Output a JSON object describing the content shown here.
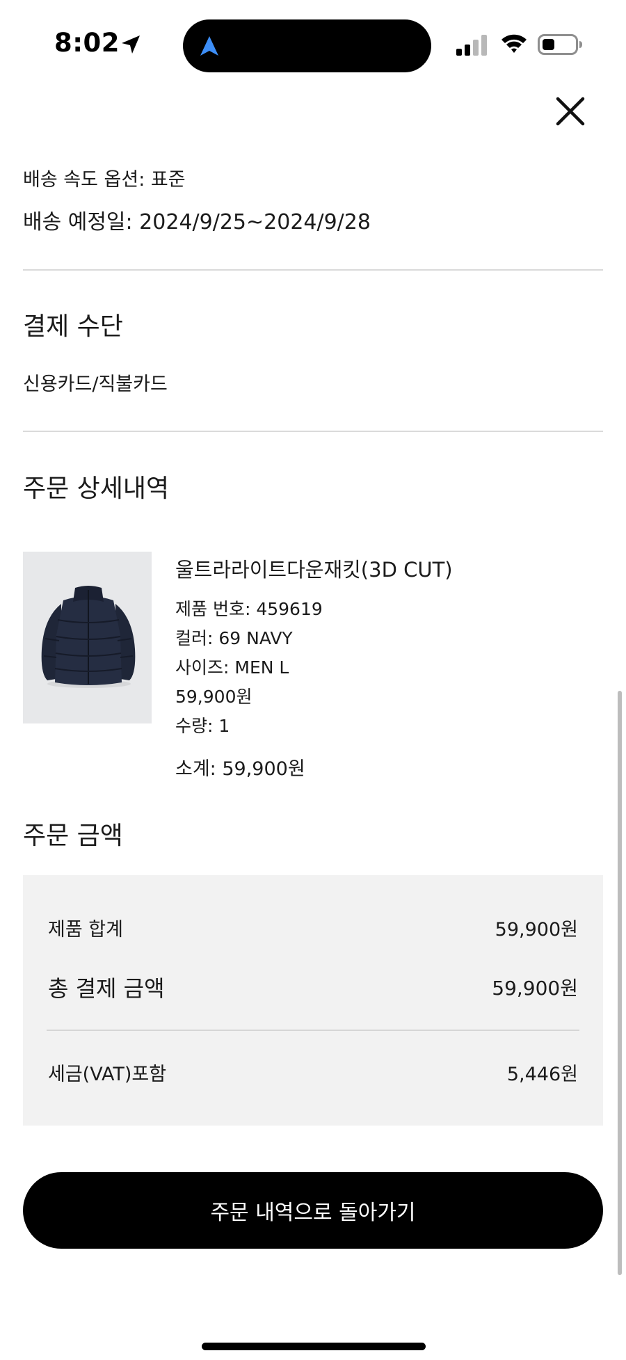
{
  "status_bar": {
    "time": "8:02",
    "icons": [
      "location-arrow-icon",
      "navigation-icon",
      "signal-icon",
      "wifi-icon",
      "battery-icon"
    ],
    "nav_icon_color": "#3d8ef7"
  },
  "header": {
    "close_icon": "close-icon"
  },
  "shipping": {
    "speed_option": "배송 속도 옵션: 표준",
    "estimated_date": "배송 예정일: 2024/9/25~2024/9/28"
  },
  "payment": {
    "title": "결제 수단",
    "method": "신용카드/직불카드"
  },
  "order_detail": {
    "title": "주문 상세내역",
    "product": {
      "name": "울트라라이트다운재킷(3D CUT)",
      "product_number": "제품 번호: 459619",
      "color": "컬러: 69 NAVY",
      "size": "사이즈: MEN L",
      "price": "59,900원",
      "quantity": "수량: 1",
      "subtotal": "소계: 59,900원"
    }
  },
  "order_amount": {
    "title": "주문 금액",
    "product_total_label": "제품 합계",
    "product_total_value": "59,900원",
    "grand_total_label": "총 결제 금액",
    "grand_total_value": "59,900원",
    "vat_label": "세금(VAT)포함",
    "vat_value": "5,446원"
  },
  "actions": {
    "back_button": "주문 내역으로 돌아가기"
  }
}
